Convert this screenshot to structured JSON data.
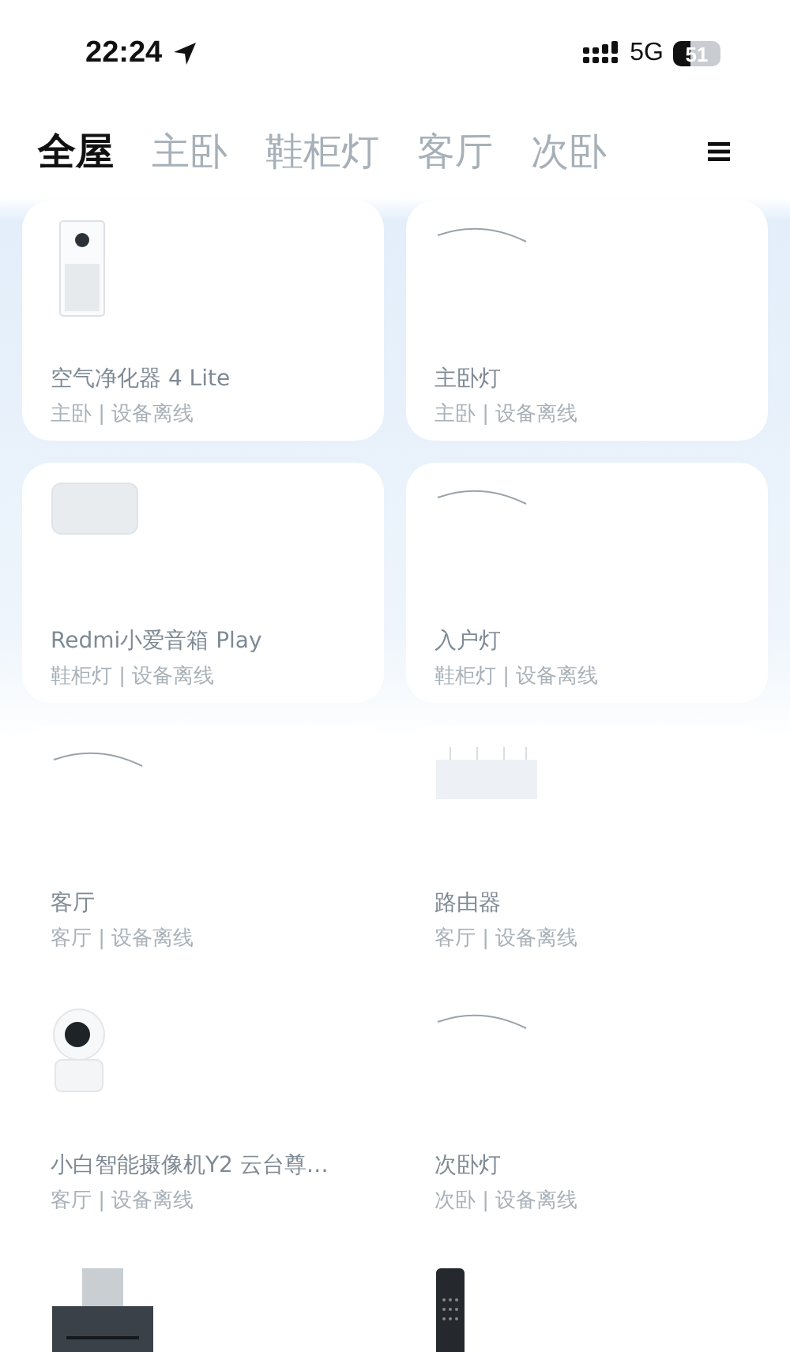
{
  "status_bar": {
    "time": "22:24",
    "network": "5G",
    "battery": "51"
  },
  "tabs": [
    {
      "label": "全屋",
      "selected": true
    },
    {
      "label": "主卧",
      "selected": false
    },
    {
      "label": "鞋柜灯",
      "selected": false
    },
    {
      "label": "客厅",
      "selected": false
    },
    {
      "label": "次卧",
      "selected": false
    }
  ],
  "devices": [
    {
      "kind": "purifier",
      "name": "空气净化器 4 Lite",
      "room": "主卧 | 设备离线"
    },
    {
      "kind": "lamp",
      "name": "主卧灯",
      "room": "主卧 | 设备离线"
    },
    {
      "kind": "speaker",
      "name": "Redmi小爱音箱 Play",
      "room": "鞋柜灯 | 设备离线"
    },
    {
      "kind": "lamp",
      "name": "入户灯",
      "room": "鞋柜灯 | 设备离线"
    },
    {
      "kind": "lamp",
      "name": "客厅",
      "room": "客厅 | 设备离线"
    },
    {
      "kind": "router",
      "name": "路由器",
      "room": "客厅 | 设备离线"
    },
    {
      "kind": "camera",
      "name": "小白智能摄像机Y2 云台尊…",
      "room": "客厅 | 设备离线"
    },
    {
      "kind": "lamp",
      "name": "次卧灯",
      "room": "次卧 | 设备离线"
    },
    {
      "kind": "appliance"
    },
    {
      "kind": "lock"
    }
  ]
}
